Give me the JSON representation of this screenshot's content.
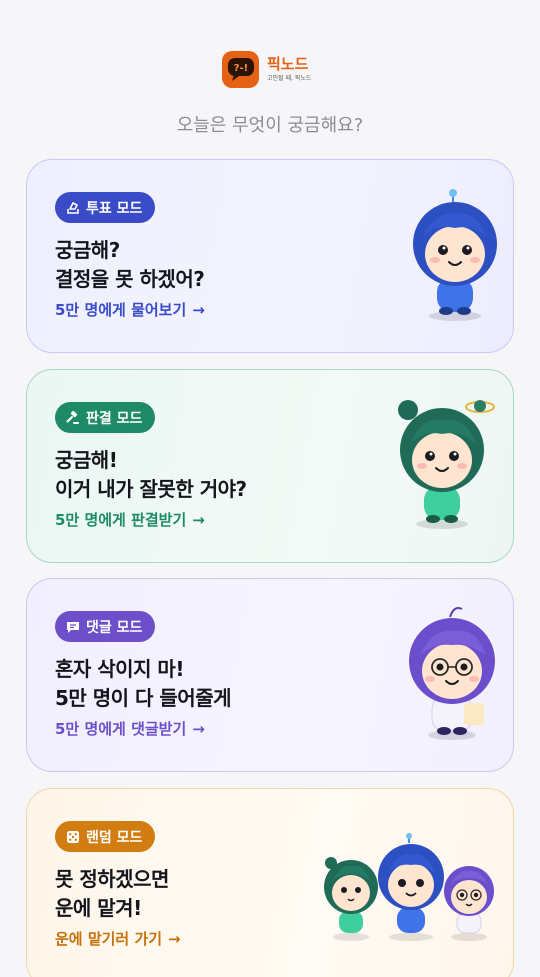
{
  "header": {
    "logo_mark": "?-!",
    "logo_title": "픽노드",
    "logo_subtitle": "고민될 때, 픽노드",
    "question": "오늘은 무엇이 궁금해요?"
  },
  "cards": [
    {
      "mode_label": "투표 모드",
      "icon": "ballot-box-icon",
      "headline_line1": "궁금해?",
      "headline_line2": "결정을 못 하겠어?",
      "link_label": "5만 명에게 물어보기",
      "accent": "#3a4bc8"
    },
    {
      "mode_label": "판결 모드",
      "icon": "gavel-icon",
      "headline_line1": "궁금해!",
      "headline_line2": "이거 내가 잘못한 거야?",
      "link_label": "5만 명에게 판결받기",
      "accent": "#1f8a68"
    },
    {
      "mode_label": "댓글 모드",
      "icon": "chat-bubble-icon",
      "headline_line1": "혼자 삭이지 마!",
      "headline_line2": "5만 명이 다 들어줄게",
      "link_label": "5만 명에게 댓글받기",
      "accent": "#6c4fc9"
    },
    {
      "mode_label": "랜덤 모드",
      "icon": "dice-icon",
      "headline_line1": "못 정하겠으면",
      "headline_line2": "운에 맡겨!",
      "link_label": "운에 맡기러 가기",
      "accent": "#d17d11"
    }
  ],
  "arrow_glyph": "→"
}
